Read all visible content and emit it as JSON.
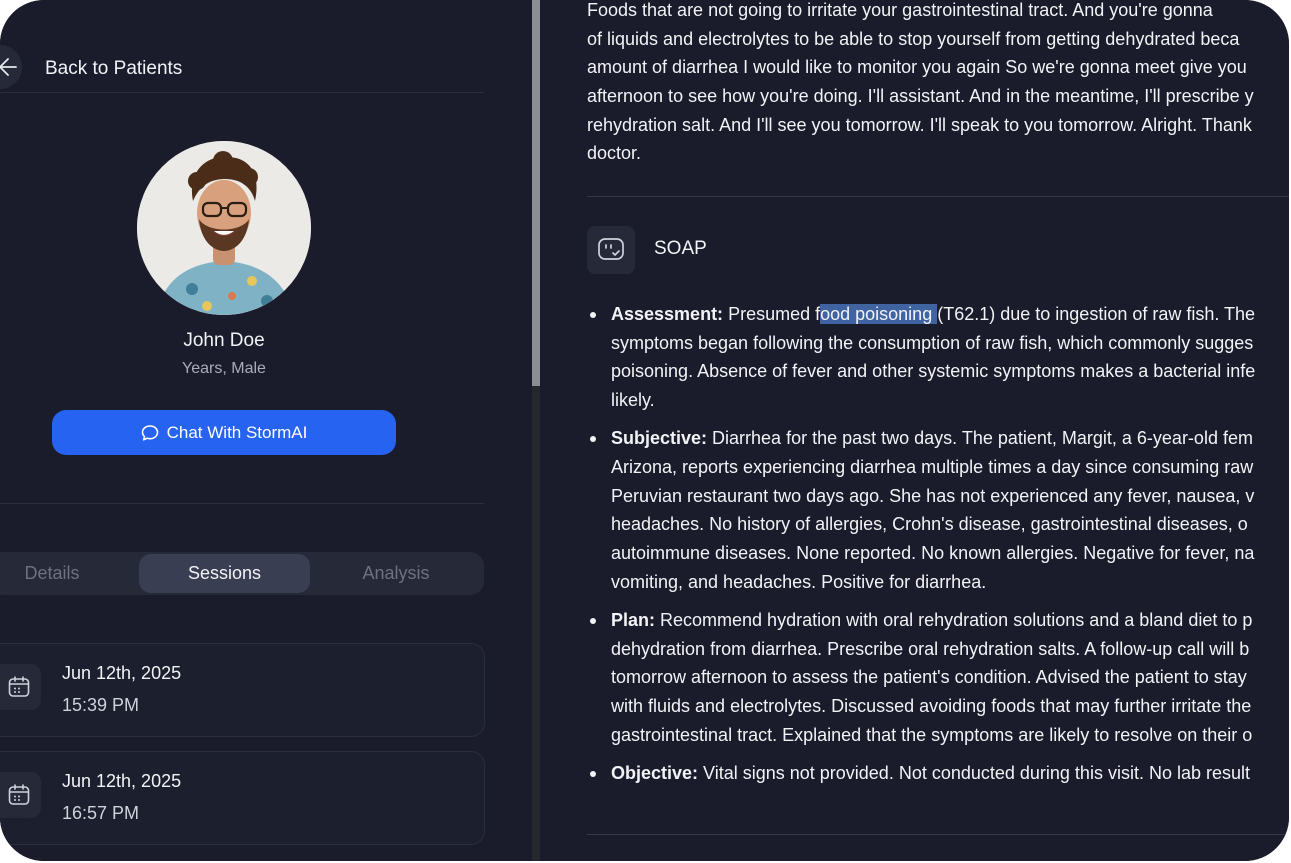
{
  "nav": {
    "back_label": "Back to Patients"
  },
  "patient": {
    "name": "John Doe",
    "meta": "Years, Male"
  },
  "chat_button": {
    "label": "Chat With StormAI"
  },
  "tabs": [
    {
      "label": "Details",
      "active": false
    },
    {
      "label": "Sessions",
      "active": true
    },
    {
      "label": "Analysis",
      "active": false
    }
  ],
  "sessions": [
    {
      "date": "Jun 12th, 2025",
      "time": "15:39 PM"
    },
    {
      "date": "Jun 12th, 2025",
      "time": "16:57 PM"
    }
  ],
  "transcript_lines": [
    "Foods that are not going to irritate your gastrointestinal tract. And you're gonna",
    "of liquids and electrolytes to be able to stop yourself from getting dehydrated beca",
    "amount of diarrhea I would like to monitor you again So we're gonna meet give you",
    "afternoon to see how you're doing. I'll assistant. And in the meantime, I'll prescribe y",
    "rehydration salt. And I'll see you tomorrow. I'll speak to you tomorrow. Alright. Thank",
    "doctor."
  ],
  "soap": {
    "title": "SOAP",
    "assessment": {
      "label": "Assessment:",
      "l1_pre": " Presumed f",
      "l1_hl": "ood poisoning ",
      "l1_post": "(T62.1) due to ingestion of raw fish. The",
      "l2": "symptoms began following the consumption of raw fish, which commonly sugges",
      "l3": "poisoning. Absence of fever and other systemic symptoms makes a bacterial infe",
      "l4": "likely."
    },
    "subjective": {
      "label": "Subjective:",
      "l1": " Diarrhea for the past two days. The patient, Margit, a 6-year-old fem",
      "l2": "Arizona, reports experiencing diarrhea multiple times a day since consuming raw",
      "l3": "Peruvian restaurant two days ago. She has not experienced any fever, nausea, v",
      "l4": "headaches. No history of allergies, Crohn's disease, gastrointestinal diseases, o",
      "l5": "autoimmune diseases. None reported. No known allergies. Negative for fever, na",
      "l6": "vomiting, and headaches. Positive for diarrhea."
    },
    "plan": {
      "label": "Plan:",
      "l1": " Recommend hydration with oral rehydration solutions and a bland diet to p",
      "l2": "dehydration from diarrhea. Prescribe oral rehydration salts. A follow-up call will b",
      "l3": "tomorrow afternoon to assess the patient's condition. Advised the patient to stay",
      "l4": "with fluids and electrolytes. Discussed avoiding foods that may further irritate the",
      "l5": "gastrointestinal tract. Explained that the symptoms are likely to resolve on their o"
    },
    "objective": {
      "label": "Objective:",
      "l1": " Vital signs not provided. Not conducted during this visit. No lab result"
    }
  },
  "colors": {
    "accent": "#2563f0",
    "background": "#1a1c2b",
    "highlight": "#3f64a1"
  },
  "icons": [
    "back-arrow-icon",
    "chat-bubble-icon",
    "calendar-icon",
    "soap-note-icon"
  ]
}
